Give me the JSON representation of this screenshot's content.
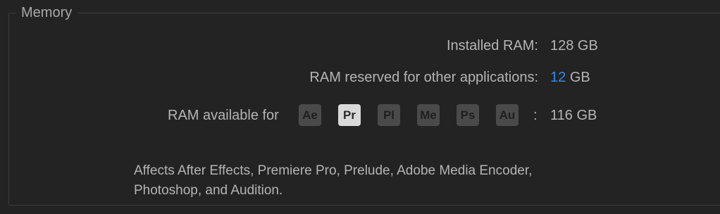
{
  "group": {
    "title": "Memory"
  },
  "installed": {
    "label": "Installed RAM:",
    "value": "128 GB"
  },
  "reserved": {
    "label": "RAM reserved for other applications:",
    "value": "12",
    "unit": "GB"
  },
  "available": {
    "label": "RAM available for",
    "separator": ":",
    "value": "116 GB",
    "apps": [
      {
        "abbr": "Ae",
        "active": false
      },
      {
        "abbr": "Pr",
        "active": true
      },
      {
        "abbr": "Pl",
        "active": false
      },
      {
        "abbr": "Me",
        "active": false
      },
      {
        "abbr": "Ps",
        "active": false
      },
      {
        "abbr": "Au",
        "active": false
      }
    ]
  },
  "note": {
    "line1": "Affects After Effects, Premiere Pro, Prelude, Adobe Media Encoder,",
    "line2": "Photoshop, and Audition."
  },
  "colors": {
    "background": "#232323",
    "text": "#b4b4b4",
    "accent": "#2d8ceb",
    "badge_inactive": "#4a4a4a",
    "badge_active": "#d9d9d9"
  }
}
